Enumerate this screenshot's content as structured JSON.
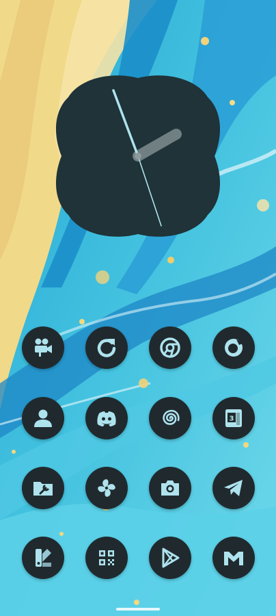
{
  "screen": {
    "type": "android-home-screen",
    "wallpaper": "blue-yellow-fluid-art",
    "icon_color": "#aee3ee",
    "icon_bg": "#202a2e"
  },
  "clock_widget": {
    "style": "analog-clover",
    "background": "#1f3338",
    "hour_hand_color": "#6f7f82",
    "minute_hand_color": "#aee3ee",
    "approx_time": "1:55"
  },
  "apps": [
    {
      "id": "video-camera",
      "icon": "movie-camera-icon"
    },
    {
      "id": "refresh",
      "icon": "refresh-icon"
    },
    {
      "id": "chrome",
      "icon": "chrome-icon"
    },
    {
      "id": "firefox",
      "icon": "firefox-icon"
    },
    {
      "id": "contacts",
      "icon": "person-icon"
    },
    {
      "id": "discord",
      "icon": "discord-icon"
    },
    {
      "id": "spiral",
      "icon": "spiral-icon"
    },
    {
      "id": "calendar",
      "icon": "calendar-icon"
    },
    {
      "id": "folder-tools",
      "icon": "folder-wrench-icon"
    },
    {
      "id": "pinwheel",
      "icon": "pinwheel-icon"
    },
    {
      "id": "camera",
      "icon": "camera-icon"
    },
    {
      "id": "telegram",
      "icon": "telegram-icon"
    },
    {
      "id": "swatches",
      "icon": "color-swatch-icon"
    },
    {
      "id": "qr-scanner",
      "icon": "qr-code-icon"
    },
    {
      "id": "play-store",
      "icon": "play-store-icon"
    },
    {
      "id": "gmail",
      "icon": "gmail-icon"
    }
  ],
  "calendar_icon_day": "3"
}
